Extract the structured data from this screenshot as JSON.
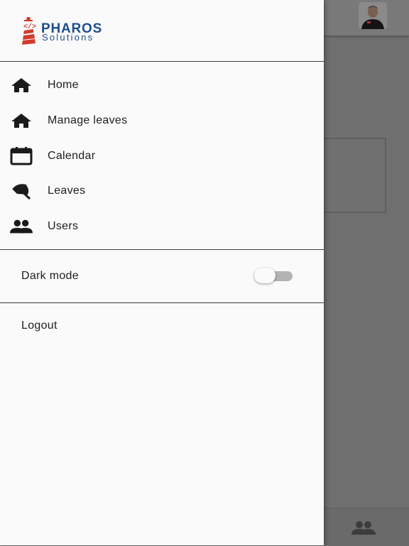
{
  "brand": {
    "name": "PHAROS",
    "subtitle": "Solutions"
  },
  "nav": {
    "items": [
      {
        "label": "Home",
        "icon": "home-icon"
      },
      {
        "label": "Manage leaves",
        "icon": "home-icon"
      },
      {
        "label": "Calendar",
        "icon": "calendar-icon"
      },
      {
        "label": "Leaves",
        "icon": "beach-umbrella-icon"
      },
      {
        "label": "Users",
        "icon": "people-icon"
      }
    ]
  },
  "settings": {
    "dark_mode_label": "Dark mode",
    "dark_mode_on": false
  },
  "logout_label": "Logout",
  "colors": {
    "brand_blue": "#1f4e8c",
    "brand_red": "#d23a2a",
    "drawer_bg": "#fafafa",
    "scrim": "#6f6f6f"
  }
}
